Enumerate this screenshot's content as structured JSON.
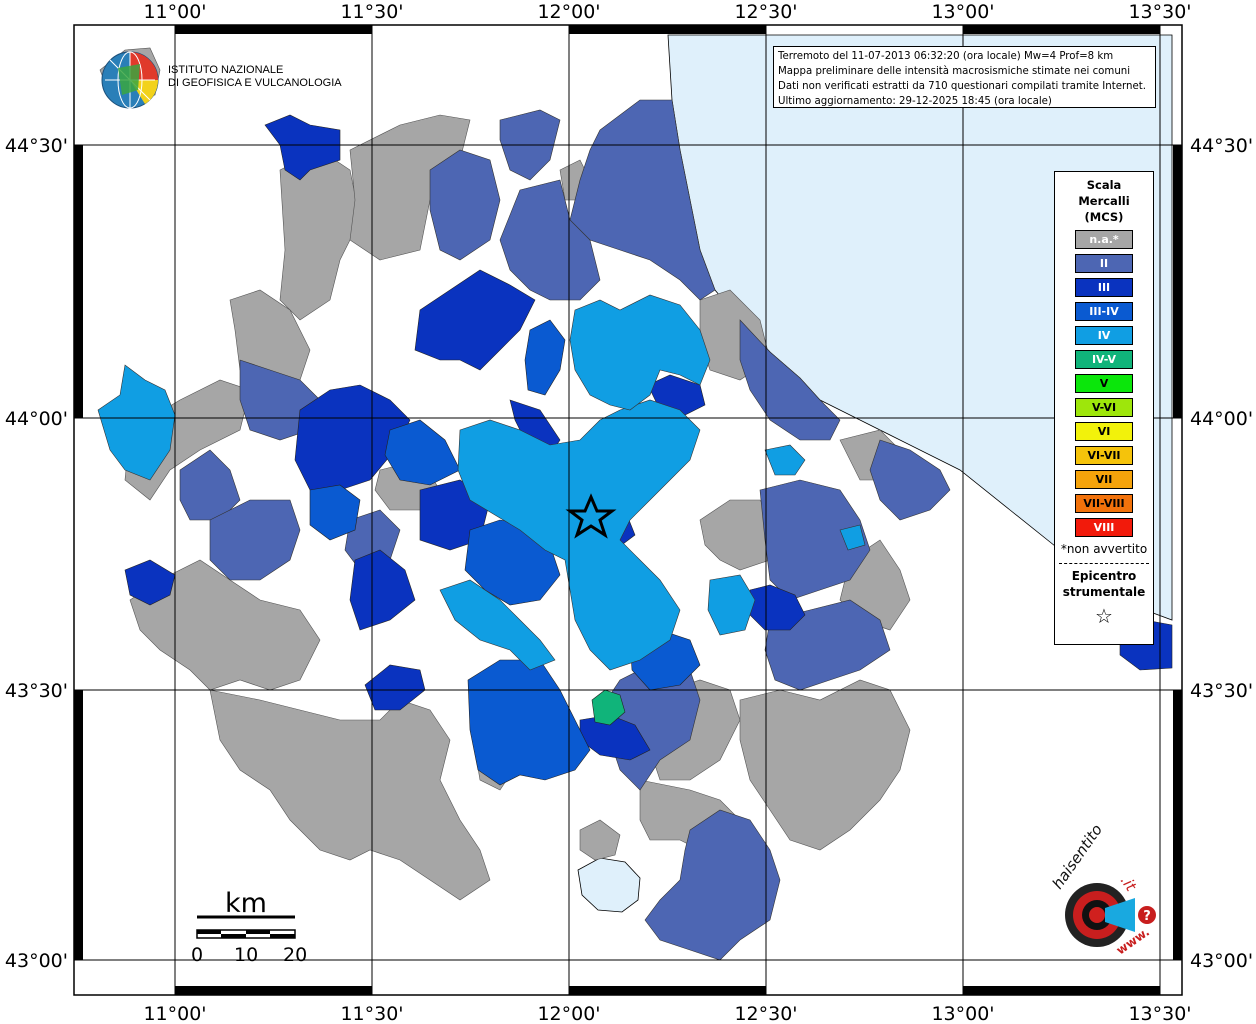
{
  "header": {
    "institute_line1": "ISTITUTO NAZIONALE",
    "institute_line2": "DI GEOFISICA E VULCANOLOGIA"
  },
  "info": {
    "line1": "Terremoto del 11-07-2013 06:32:20 (ora locale) Mw=4 Prof=8 km",
    "line2": "Mappa preliminare delle intensità macrosismiche stimate nei comuni",
    "line3": "Dati non verificati estratti da 710 questionari compilati tramite Internet.",
    "line4": "Ultimo aggiornamento: 29-12-2025 18:45 (ora locale)"
  },
  "axes": {
    "lon_top": [
      "11°00'",
      "11°30'",
      "12°00'",
      "12°30'",
      "13°00'",
      "13°30'"
    ],
    "lon_bottom": [
      "11°00'",
      "11°30'",
      "12°00'",
      "12°30'",
      "13°00'",
      "13°30'"
    ],
    "lat_left": [
      "44°30'",
      "44°00'",
      "43°30'",
      "43°00'"
    ],
    "lat_right": [
      "44°30'",
      "44°00'",
      "43°30'",
      "43°00'"
    ]
  },
  "legend": {
    "title1": "Scala",
    "title2": "Mercalli",
    "title3": "(MCS)",
    "items": [
      {
        "label": "n.a.*",
        "color": "#a6a6a6",
        "text_color": "#ffffff"
      },
      {
        "label": "II",
        "color": "#4d66b3",
        "text_color": "#ffffff"
      },
      {
        "label": "III",
        "color": "#0a33bf",
        "text_color": "#ffffff"
      },
      {
        "label": "III-IV",
        "color": "#0a5ad1",
        "text_color": "#ffffff"
      },
      {
        "label": "IV",
        "color": "#109ee3",
        "text_color": "#ffffff"
      },
      {
        "label": "IV-V",
        "color": "#10b47a",
        "text_color": "#ffffff"
      },
      {
        "label": "V",
        "color": "#0be60b",
        "text_color": "#000000"
      },
      {
        "label": "V-VI",
        "color": "#9ee60b",
        "text_color": "#000000"
      },
      {
        "label": "VI",
        "color": "#f2f20b",
        "text_color": "#000000"
      },
      {
        "label": "VI-VII",
        "color": "#f5c30b",
        "text_color": "#000000"
      },
      {
        "label": "VII",
        "color": "#f5a30b",
        "text_color": "#000000"
      },
      {
        "label": "VII-VIII",
        "color": "#f2720b",
        "text_color": "#000000"
      },
      {
        "label": "VIII",
        "color": "#f21a0b",
        "text_color": "#ffffff"
      }
    ],
    "note": "*non avvertito",
    "epicenter1": "Epicentro",
    "epicenter2": "strumentale",
    "epicenter_symbol": "☆"
  },
  "scalebar": {
    "unit": "km",
    "ticks": [
      "0",
      "10",
      "20"
    ]
  },
  "colors": {
    "sea": "#dff0fb",
    "na": "#a6a6a6",
    "II": "#4d66b3",
    "III": "#0a33bf",
    "III_IV": "#0a5ad1",
    "IV": "#109ee3",
    "IV_V": "#10b47a"
  },
  "footer_logo": {
    "text": "haisentitoilterremoto.it",
    "url_text": "www."
  }
}
